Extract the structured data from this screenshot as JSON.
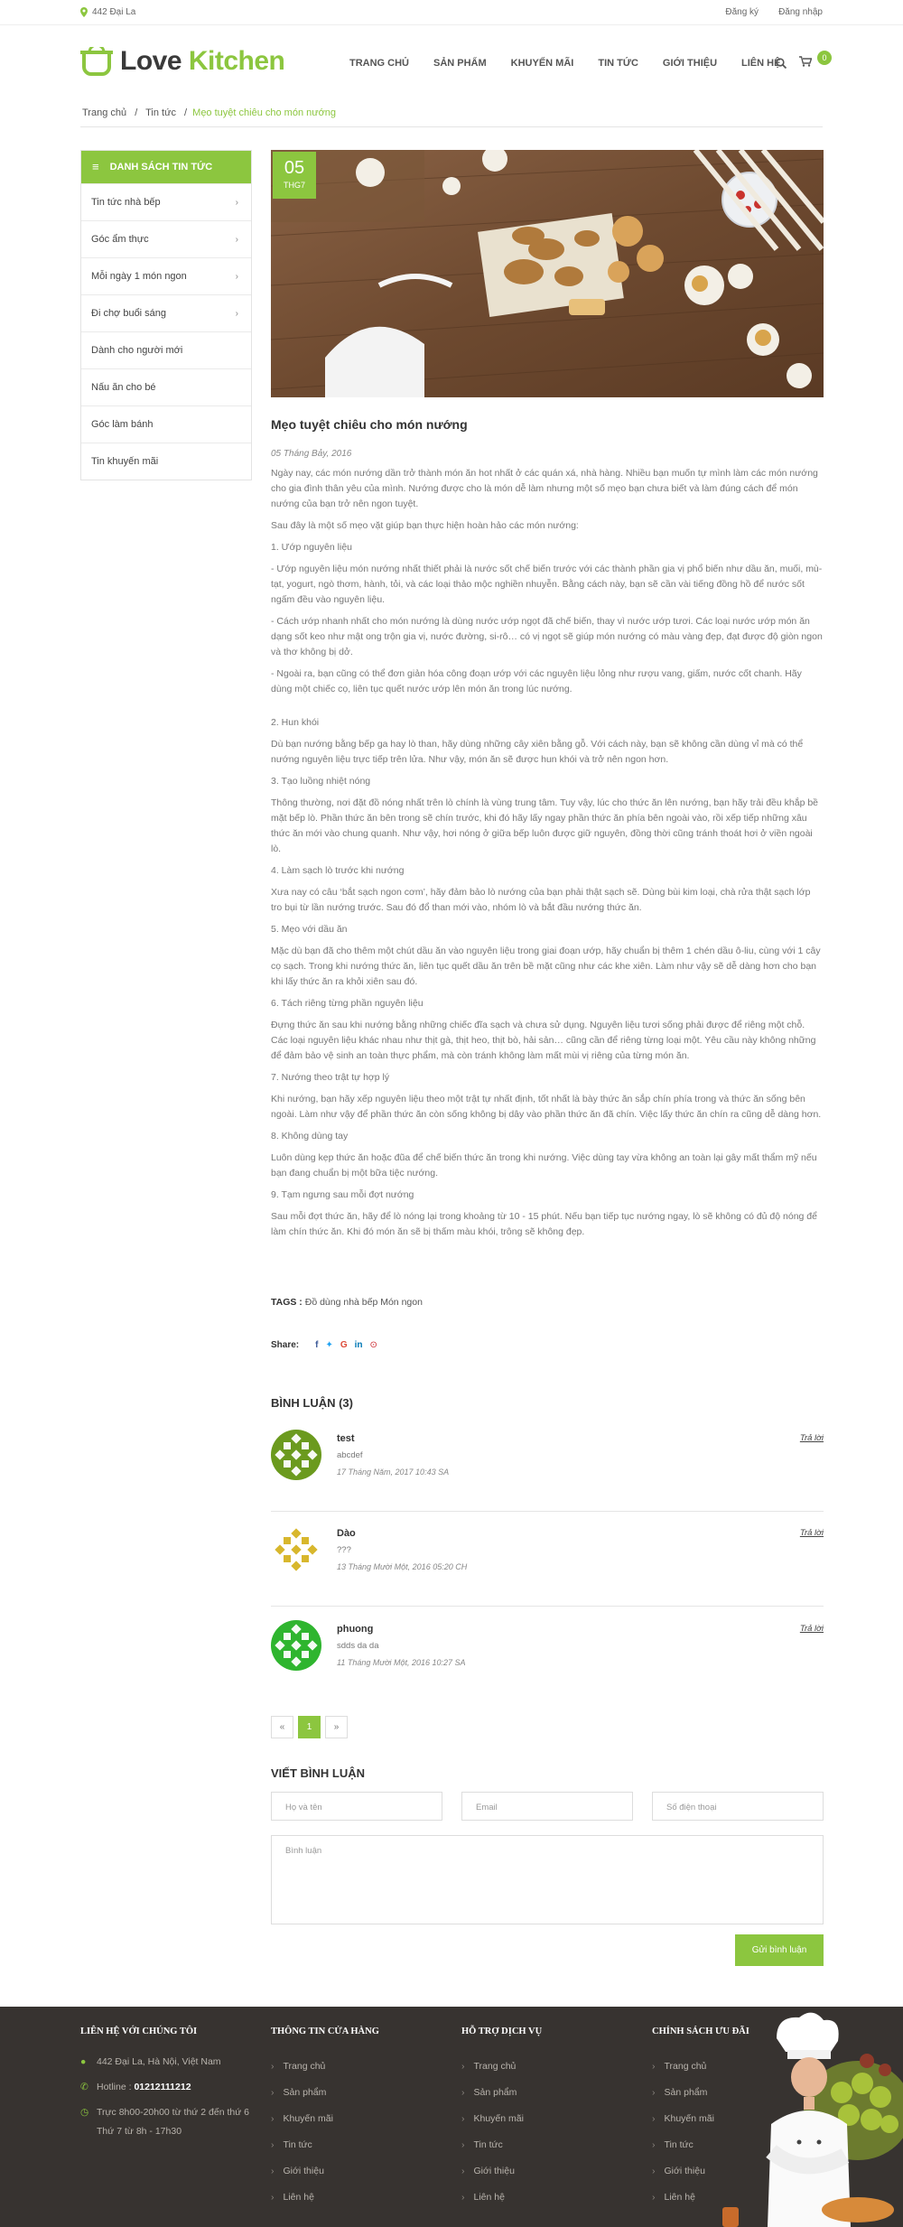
{
  "topbar": {
    "address": "442 Đại La",
    "register": "Đăng ký",
    "login": "Đăng nhập"
  },
  "brand": {
    "word1": "Love",
    "word2": "Kitchen",
    "accent": "#8cc63f",
    "dark": "#3a3a3a"
  },
  "nav": [
    "TRANG CHỦ",
    "SẢN PHẨM",
    "KHUYẾN MÃI",
    "TIN TỨC",
    "GIỚI THIỆU",
    "LIÊN HỆ"
  ],
  "cart": {
    "count": "0"
  },
  "breadcrumb": {
    "home": "Trang chủ",
    "section": "Tin tức",
    "current": "Mẹo tuyệt chiêu cho món nướng",
    "sep": "/"
  },
  "sidebar": {
    "title": "DANH SÁCH TIN TỨC",
    "items": [
      {
        "label": "Tin tức nhà bếp",
        "has_sub": true
      },
      {
        "label": "Góc ẩm thực",
        "has_sub": true
      },
      {
        "label": "Mỗi ngày 1 món ngon",
        "has_sub": true
      },
      {
        "label": "Đi chợ buổi sáng",
        "has_sub": true
      },
      {
        "label": "Dành cho người mới",
        "has_sub": false
      },
      {
        "label": "Nấu ăn cho bé",
        "has_sub": false
      },
      {
        "label": "Góc làm bánh",
        "has_sub": false
      },
      {
        "label": "Tin khuyến mãi",
        "has_sub": false
      }
    ]
  },
  "post": {
    "day": "05",
    "month": "THG7",
    "title": "Mẹo tuyệt chiêu cho món nướng",
    "date": "05 Tháng Bảy, 2016",
    "paragraphs": [
      "Ngày nay, các món nướng dần trở thành món ăn hot nhất ở các quán xá, nhà hàng. Nhiều bạn muốn tự mình làm các món nướng cho gia đình thân yêu của mình. Nướng được cho là món dễ làm nhưng một số mẹo bạn chưa biết và làm đúng cách để món nướng của bạn trở nên ngon tuyệt.",
      "Sau đây là một số mẹo vặt giúp bạn thực hiện hoàn hảo các món nướng:",
      "1. Ướp nguyên liệu",
      "- Ướp nguyên liệu món nướng nhất thiết phải là nước sốt chế biến trước với các thành phần gia vị phổ biến như dầu ăn, muối, mù-tạt, yogurt, ngò thơm, hành, tỏi, và các loại thảo mộc nghiền nhuyễn. Bằng cách này, bạn sẽ cần vài tiếng đồng hồ để nước sốt ngấm đều vào nguyên liệu.",
      "- Cách ướp nhanh nhất cho món nướng là dùng nước ướp ngọt đã chế biến, thay vì nước ướp tươi. Các loại nước ướp món ăn dạng sốt keo như mật ong trộn gia vị, nước đường, si-rô… có vị ngọt sẽ giúp món nướng có màu vàng đẹp, đạt được độ giòn ngon và thơ không bị dở.",
      "- Ngoài ra, bạn cũng có thể đơn giản hóa công đoạn ướp với các nguyên liệu lỏng như rượu vang, giấm, nước cốt chanh. Hãy dùng một chiếc cọ, liên tục quết nước ướp lên món ăn trong lúc nướng.",
      "2. Hun khói",
      "Dù bạn nướng bằng bếp ga hay lò than, hãy dùng những cây xiên bằng gỗ. Với cách này, bạn sẽ không cần dùng vỉ mà có thể nướng nguyên liệu trực tiếp trên lửa. Như vậy, món ăn sẽ được hun khói và trở nên ngon hơn.",
      "3. Tạo luồng nhiệt nóng",
      "Thông thường, nơi đặt đồ nóng nhất trên lò chính là vùng trung tâm. Tuy vậy, lúc cho thức ăn lên nướng, bạn hãy trải đều khắp bề mặt bếp lò. Phần thức ăn bên trong sẽ chín trước, khi đó hãy lấy ngay phần thức ăn phía bên ngoài vào, rồi xếp tiếp những xâu thức ăn mới vào chung quanh. Như vậy, hơi nóng ở giữa bếp luôn được giữ nguyên, đồng thời cũng tránh thoát hơi ở viền ngoài lò.",
      "4. Làm sạch lò trước khi nướng",
      "Xưa nay có câu ‘bắt sạch ngon cơm’, hãy đảm bảo lò nướng của bạn phải thật sạch sẽ. Dùng bùi kim loại, chà rửa thật sạch lớp tro bụi từ lần nướng trước. Sau đó đổ than mới vào, nhóm lò và bắt đầu nướng thức ăn.",
      "5. Mẹo với dầu ăn",
      "Mặc dù bạn đã cho thêm một chút dầu ăn vào nguyên liệu trong giai đoạn ướp, hãy chuẩn bị thêm 1 chén dầu ô-liu, cùng với 1 cây cọ sạch. Trong khi nướng thức ăn, liên tục quết dầu ăn trên bề mặt cũng như các khe xiên. Làm như vậy sẽ dễ dàng hơn cho bạn khi lấy thức ăn ra khỏi xiên sau đó.",
      "6. Tách riêng từng phần nguyên liệu",
      "Đựng thức ăn sau khi nướng bằng những chiếc đĩa sạch và chưa sử dụng. Nguyên liệu tươi sống phải được để riêng một chỗ. Các loại nguyên liệu khác nhau như thịt gà, thịt heo, thịt bò, hải sản… cũng cần để riêng từng loại một. Yêu cầu này không những để đảm bảo vệ sinh an toàn thực phẩm, mà còn tránh không làm mất mùi vị riêng của từng món ăn.",
      "7. Nướng theo trật tự hợp lý",
      "Khi nướng, bạn hãy xếp nguyên liệu theo một trật tự nhất định, tốt nhất là bày thức ăn sắp chín phía trong và thức ăn sống bên ngoài. Làm như vậy để phần thức ăn còn sống không bị dây vào phần thức ăn đã chín. Việc lấy thức ăn chín ra cũng dễ dàng hơn.",
      "8. Không dùng tay",
      "Luôn dùng kẹp thức ăn hoặc đũa để chế biến thức ăn trong khi nướng. Việc dùng tay vừa không an toàn lại gây mất thẩm mỹ nếu bạn đang chuẩn bị một bữa tiệc nướng.",
      "9. Tạm ngưng sau mỗi đợt nướng",
      "Sau mỗi đợt thức ăn, hãy để lò nóng lại trong khoảng từ 10 - 15 phút. Nếu bạn tiếp tục nướng ngay, lò sẽ không có đủ độ nóng để làm chín thức ăn. Khi đó món ăn sẽ bị thấm màu khói, trông sẽ không đẹp."
    ],
    "tags_label": "TAGS :",
    "tags": "Đồ dùng nhà bếp Món ngon",
    "share_label": "Share:"
  },
  "comments": {
    "title": "BÌNH LUẬN (3)",
    "reply_label": "Trả lời",
    "items": [
      {
        "name": "test",
        "text": "abcdef",
        "date": "17 Tháng Năm, 2017 10:43 SA",
        "color": "#6b9a1e"
      },
      {
        "name": "Dào",
        "text": "???",
        "date": "13 Tháng Mười Một, 2016 05:20 CH",
        "color": "#d6b422"
      },
      {
        "name": "phuong",
        "text": "sdds da da",
        "date": "11 Tháng Mười Một, 2016 10:27 SA",
        "color": "#2fb52f"
      }
    ]
  },
  "pager": {
    "prev": "«",
    "page": "1",
    "next": "»"
  },
  "form": {
    "title": "VIẾT BÌNH LUẬN",
    "name": "Họ và tên",
    "email": "Email",
    "phone": "Số điện thoại",
    "content": "Bình luận",
    "submit": "Gửi bình luận"
  },
  "footer": {
    "contact": {
      "title": "LIÊN HỆ VỚI CHÚNG TÔI",
      "address": "442 Đại La, Hà Nội, Việt Nam",
      "hotline_label": "Hotline :",
      "hotline": "01212111212",
      "hours1": "Trực 8h00-20h00 từ thứ 2 đến thứ 6",
      "hours2": "Thứ 7 từ 8h - 17h30"
    },
    "columns": [
      {
        "title": "THÔNG TIN CỬA HÀNG",
        "items": [
          "Trang chủ",
          "Sản phẩm",
          "Khuyến mãi",
          "Tin tức",
          "Giới thiệu",
          "Liên hệ"
        ]
      },
      {
        "title": "HỖ TRỢ DỊCH VỤ",
        "items": [
          "Trang chủ",
          "Sản phẩm",
          "Khuyến mãi",
          "Tin tức",
          "Giới thiệu",
          "Liên hệ"
        ]
      },
      {
        "title": "CHÍNH SÁCH ƯU ĐÃI",
        "items": [
          "Trang chủ",
          "Sản phẩm",
          "Khuyến mãi",
          "Tin tức",
          "Giới thiệu",
          "Liên hệ"
        ]
      }
    ]
  }
}
